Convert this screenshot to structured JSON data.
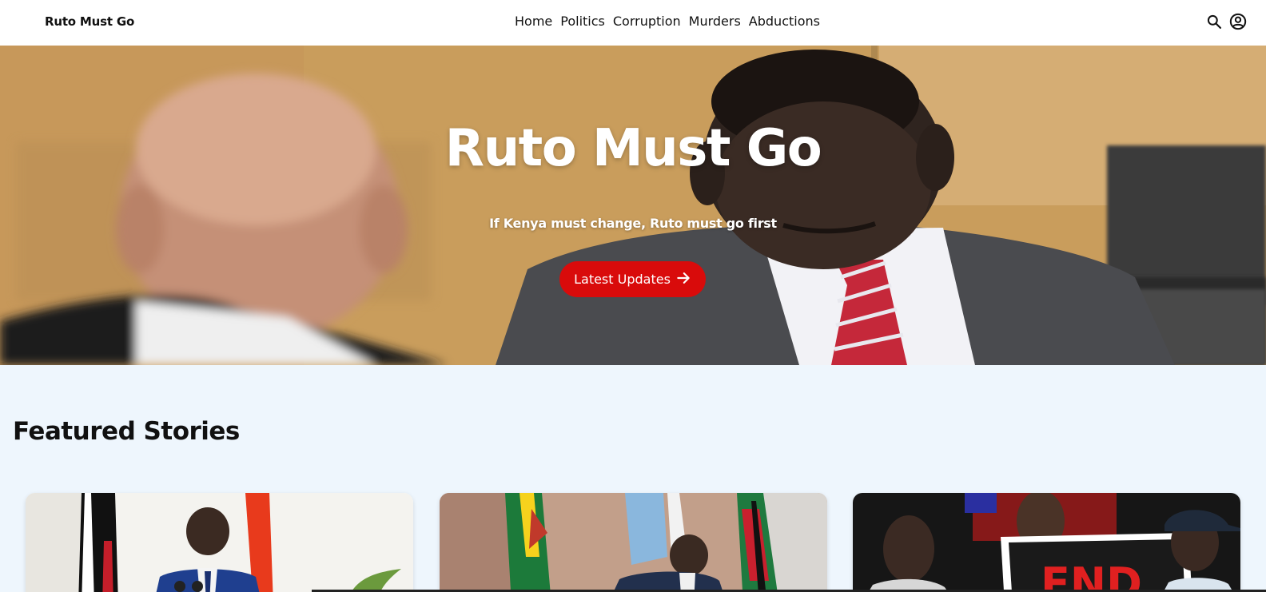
{
  "header": {
    "brand": "Ruto Must Go",
    "nav": [
      {
        "label": "Home"
      },
      {
        "label": "Politics"
      },
      {
        "label": "Corruption"
      },
      {
        "label": "Murders"
      },
      {
        "label": "Abductions"
      }
    ],
    "icons": [
      "search-icon",
      "account-icon"
    ]
  },
  "hero": {
    "title": "Ruto Must Go",
    "subtitle": "If Kenya must change, Ruto must go first",
    "cta_label": "Latest Updates",
    "cta_icon": "arrow-right-icon",
    "cta_color": "#d90b0b"
  },
  "featured": {
    "title": "Featured Stories",
    "cards": [
      {
        "image": "president-podium-photo"
      },
      {
        "image": "president-signing-photo"
      },
      {
        "image": "protesters-photo",
        "sign_text": "END"
      }
    ]
  },
  "colors": {
    "accent": "#d90b0b",
    "page_background": "#eef6fd",
    "header_background": "#ffffff"
  }
}
